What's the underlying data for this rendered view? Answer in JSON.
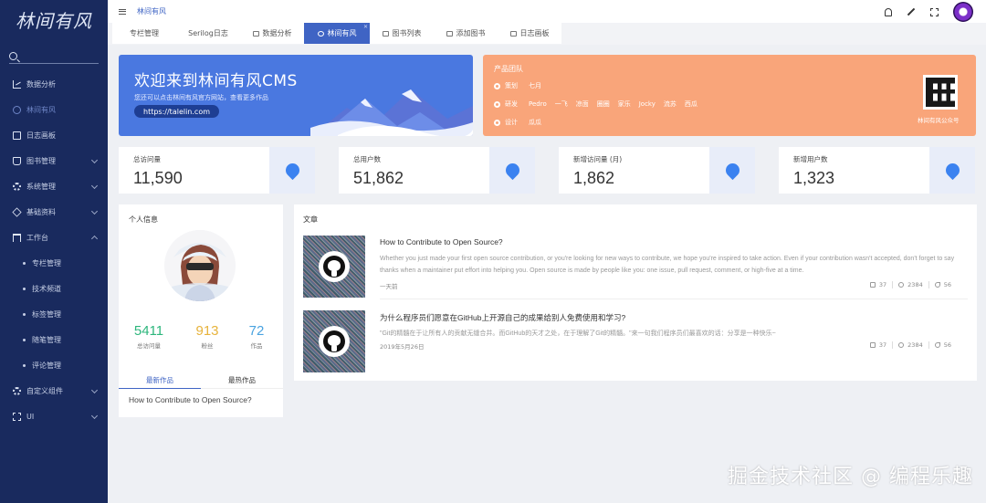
{
  "sidebar": {
    "logo": "林间有风",
    "items": [
      {
        "label": "数据分析",
        "icon": "chart-icon"
      },
      {
        "label": "林间有风",
        "icon": "circle-icon",
        "active": true
      },
      {
        "label": "日志画板",
        "icon": "document-icon"
      },
      {
        "label": "图书管理",
        "icon": "book-icon",
        "expandable": true
      },
      {
        "label": "系统管理",
        "icon": "gear-icon",
        "expandable": true
      },
      {
        "label": "基础资料",
        "icon": "box-icon",
        "expandable": true
      },
      {
        "label": "工作台",
        "icon": "desk-icon",
        "expanded": true
      }
    ],
    "subitems": [
      "专栏管理",
      "技术频道",
      "标签管理",
      "随笔管理",
      "评论管理"
    ],
    "bottom_items": [
      {
        "label": "自定义组件",
        "icon": "gear-icon"
      },
      {
        "label": "UI",
        "icon": "grid-icon"
      }
    ]
  },
  "topbar": {
    "breadcrumb": "林间有风"
  },
  "tabs": [
    {
      "label": "专栏管理"
    },
    {
      "label": "Serilog日志"
    },
    {
      "label": "数据分析"
    },
    {
      "label": "林间有风",
      "active": true
    },
    {
      "label": "图书列表"
    },
    {
      "label": "添加图书"
    },
    {
      "label": "日志画板"
    }
  ],
  "welcome": {
    "title": "欢迎来到林间有风CMS",
    "desc": "您还可以点击林间有风官方网站，查看更多作品",
    "url": "https://talelin.com"
  },
  "team": {
    "title": "产品团队",
    "rows": [
      {
        "role": "策划",
        "people": [
          "七月"
        ]
      },
      {
        "role": "研发",
        "people": [
          "Pedro",
          "一飞",
          "凉面",
          "圈圈",
          "家乐",
          "Jocky",
          "流苏",
          "西瓜"
        ]
      },
      {
        "role": "设计",
        "people": [
          "瓜瓜"
        ]
      }
    ],
    "qr_label": "林间有风公众号"
  },
  "stats": [
    {
      "label": "总访问量",
      "value": "11,590"
    },
    {
      "label": "总用户数",
      "value": "51,862"
    },
    {
      "label": "新增访问量 (月)",
      "value": "1,862"
    },
    {
      "label": "新增用户数",
      "value": "1,323"
    }
  ],
  "profile": {
    "title": "个人信息",
    "stats": [
      {
        "num": "5411",
        "cap": "总访问量",
        "color": "#2db67c"
      },
      {
        "num": "913",
        "cap": "粉丝",
        "color": "#e7b33c"
      },
      {
        "num": "72",
        "cap": "作品",
        "color": "#4aa3e0"
      }
    ],
    "tabs": [
      "最新作品",
      "最热作品"
    ],
    "latest_work": "How to Contribute to Open Source?"
  },
  "articles": {
    "title": "文章",
    "items": [
      {
        "title": "How to Contribute to Open Source?",
        "excerpt": "Whether you just made your first open source contribution, or you're looking for new ways to contribute, we hope you're inspired to take action. Even if your contribution wasn't accepted, don't forget to say thanks when a maintainer put effort into helping you. Open source is made by people like you: one issue, pull request, comment, or high-five at a time.",
        "date": "一天前",
        "likes": "37",
        "comments": "2384",
        "shares": "56"
      },
      {
        "title": "为什么程序员们愿意在GitHub上开源自己的成果给别人免费使用和学习?",
        "excerpt": "\"Git的精髓在于让所有人的贡献无缝合并。而GitHub的天才之处，在于理解了Git的精髓。\"来一句我们程序员们最喜欢的话：分享是一种快乐~",
        "date": "2019年5月26日",
        "likes": "37",
        "comments": "2384",
        "shares": "56"
      }
    ]
  },
  "watermark": "掘金技术社区 @ 编程乐趣",
  "colors": {
    "sidebar": "#192a5e",
    "accent": "#3f64c4",
    "banner_blue": "#4a78e0",
    "banner_orange": "#f9a57a"
  }
}
